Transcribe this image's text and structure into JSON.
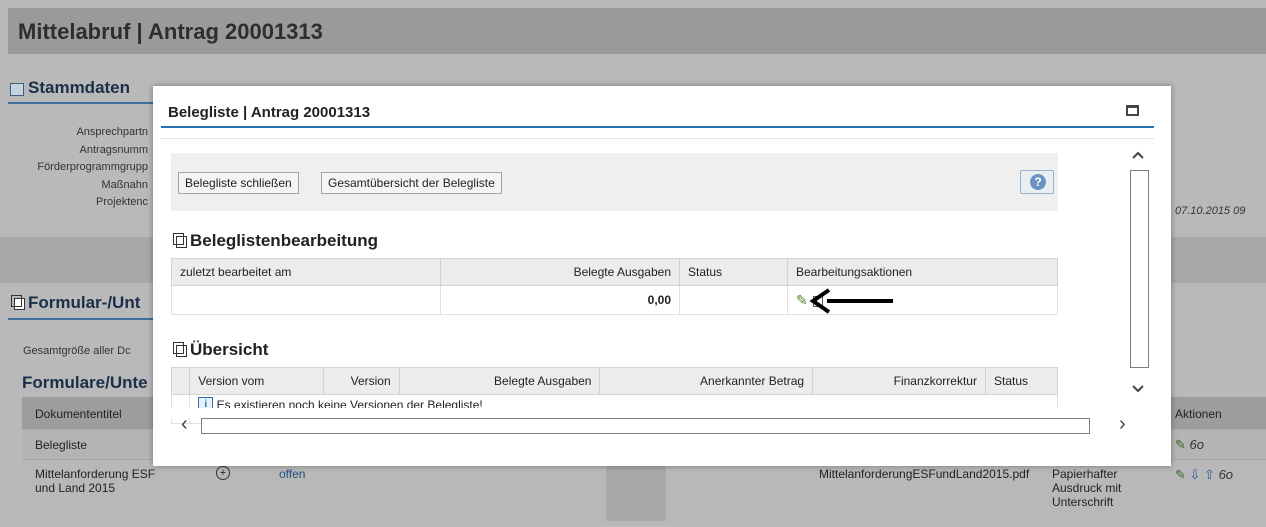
{
  "page": {
    "title": "Mittelabruf | Antrag 20001313",
    "stammdaten": {
      "title": "Stammdaten",
      "fields": [
        "Ansprechpartn",
        "Antragsnumm",
        "Förderprogrammgrupp",
        "Maßnahn",
        "Projektenc"
      ],
      "date_value": "07.10.2015 09"
    },
    "formular_title": "Formular-/Unt",
    "gesamtgroesse_label": "Gesamtgröße aller Dc",
    "formulare_title": "Formulare/Unte",
    "docs_table": {
      "col_dokumententitel": "Dokumententitel",
      "col_aktionen": "Aktionen",
      "row1_title": "Belegliste",
      "row2_title": "Mittelanforderung ESF und Land 2015",
      "row2_status": "offen",
      "row2_file": "MittelanforderungESFundLand2015.pdf",
      "row2_type": "Papierhafter Ausdruck mit Unterschrift"
    }
  },
  "dialog": {
    "title": "Belegliste | Antrag 20001313",
    "buttons": {
      "close": "Belegliste schließen",
      "overview": "Gesamtübersicht der Belegliste",
      "help": "?"
    },
    "bearbeitung": {
      "title": "Beleglistenbearbeitung",
      "headers": [
        "zuletzt bearbeitet am",
        "Belegte Ausgaben",
        "Status",
        "Bearbeitungsaktionen"
      ],
      "row": {
        "date": "",
        "amount": "0,00",
        "status": ""
      }
    },
    "uebersicht": {
      "title": "Übersicht",
      "headers": [
        "Version vom",
        "Version",
        "Belegte Ausgaben",
        "Anerkannter Betrag",
        "Finanzkorrektur",
        "Status"
      ],
      "empty_message": "Es existieren noch keine Versionen der Belegliste!"
    }
  },
  "colors": {
    "accent_rule": "#2a70ae",
    "section_title": "#1b2f4a"
  },
  "icons": [
    "window-icon",
    "copy-icon",
    "pencil-icon",
    "arrow-left-icon",
    "info-icon",
    "help-icon",
    "maximize-icon",
    "chevron-up-icon",
    "chevron-down-icon",
    "chevron-left-icon",
    "chevron-right-icon"
  ]
}
